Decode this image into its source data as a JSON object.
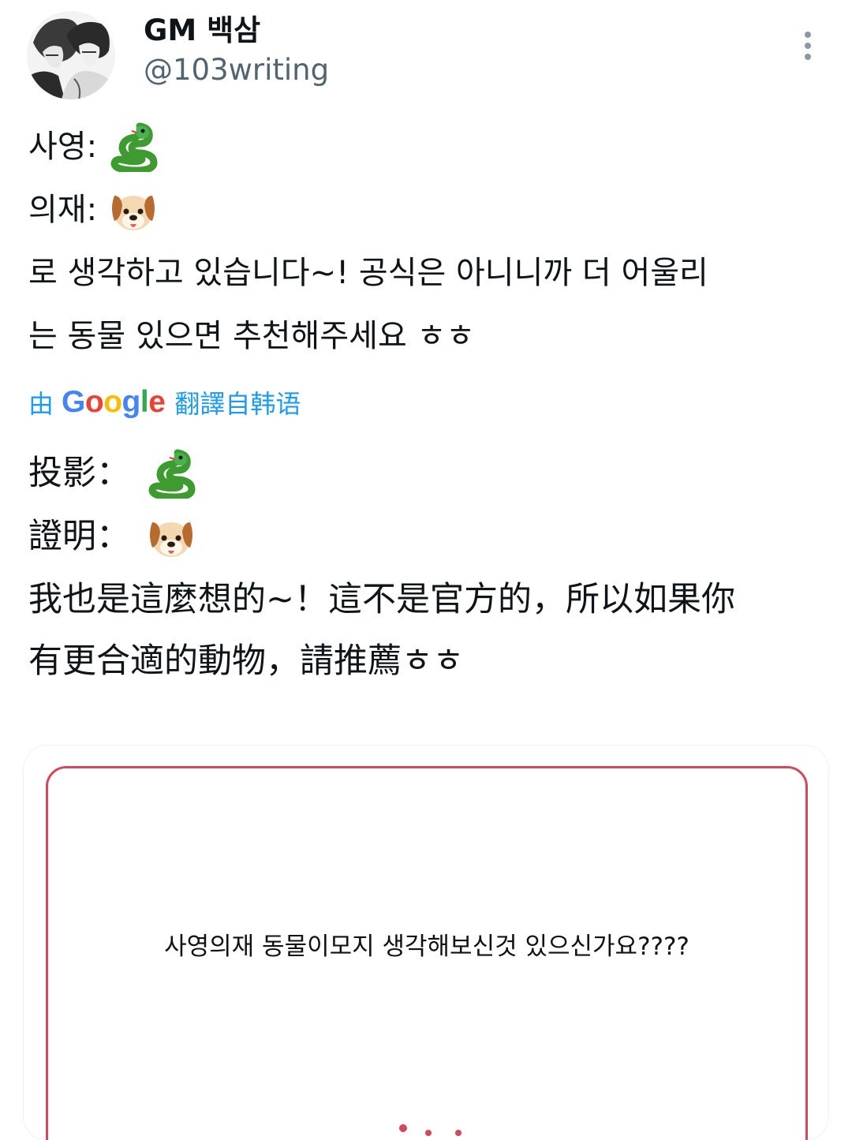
{
  "tweet": {
    "author": {
      "display_name": "GM 백삼",
      "handle": "@103writing"
    },
    "lines_ko": [
      {
        "text": "사영:",
        "emoji": "snake-emoji"
      },
      {
        "text": "의재:",
        "emoji": "dog-face-emoji"
      },
      {
        "text": "로 생각하고 있습니다~! 공식은 아니니까 더 어울리"
      },
      {
        "text": "는 동물 있으면 추천해주세요 ㅎㅎ"
      }
    ],
    "translation": {
      "prefix": "由",
      "brand": "Google",
      "suffix": "翻譯自韩语"
    },
    "lines_zh": [
      {
        "text": "投影：",
        "emoji": "snake-emoji"
      },
      {
        "text": "證明：",
        "emoji": "dog-face-emoji"
      },
      {
        "text": "我也是這麼想的~！這不是官方的，所以如果你"
      },
      {
        "text": "有更合適的動物，請推薦ㅎㅎ"
      }
    ],
    "media": {
      "caption": "사영의재 동물이모지 생각해보신것 있으신가요????",
      "frame_color": "#d3485a"
    }
  },
  "colors": {
    "text": "#0f1419",
    "secondary": "#536471",
    "link": "#1d9bf0"
  }
}
